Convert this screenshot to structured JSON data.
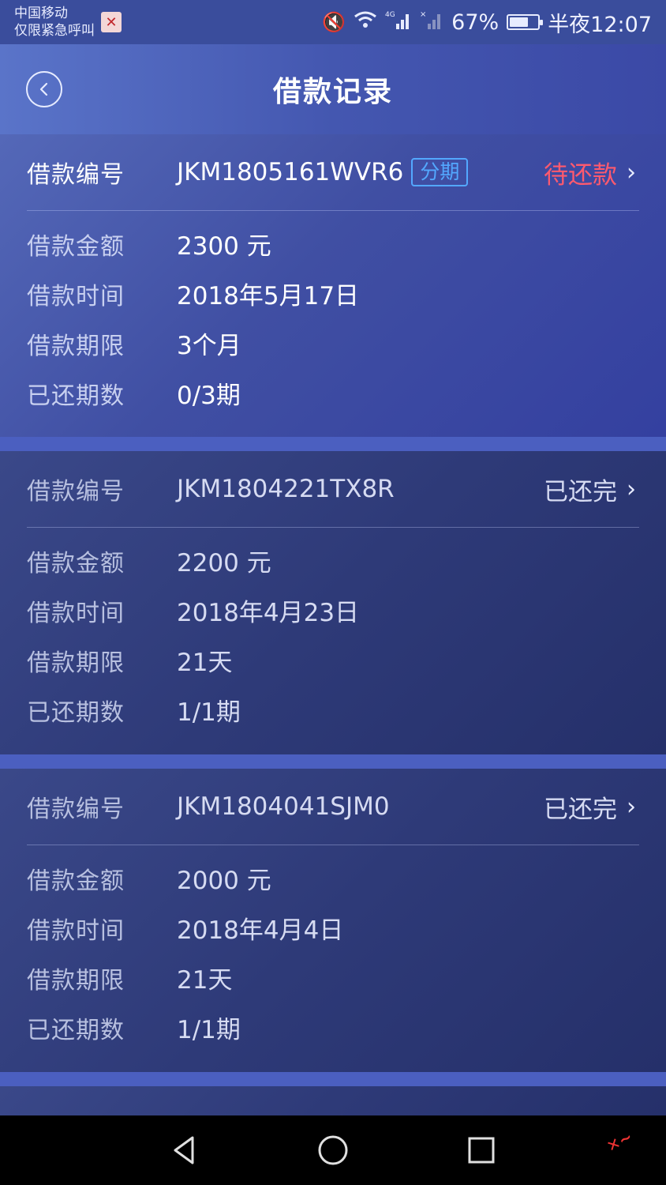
{
  "status_bar": {
    "carrier": "中国移动",
    "carrier_sub": "仅限紧急呼叫",
    "app_icon": "notification-app-icon",
    "network_label": "4G",
    "battery_percent": "67%",
    "battery_level": 0.67,
    "time": "半夜12:07"
  },
  "header": {
    "title": "借款记录",
    "back_icon": "back-chevron-icon"
  },
  "loans": [
    {
      "id_label": "借款编号",
      "id": "JKM1805161WVR6",
      "tag": "分期",
      "status": "待还款",
      "amount_label": "借款金额",
      "amount": "2300 元",
      "date_label": "借款时间",
      "date": "2018年5月17日",
      "term_label": "借款期限",
      "term": "3个月",
      "paid_label": "已还期数",
      "paid": "0/3期"
    },
    {
      "id_label": "借款编号",
      "id": "JKM1804221TX8R",
      "status": "已还完",
      "amount_label": "借款金额",
      "amount": "2200 元",
      "date_label": "借款时间",
      "date": "2018年4月23日",
      "term_label": "借款期限",
      "term": "21天",
      "paid_label": "已还期数",
      "paid": "1/1期"
    },
    {
      "id_label": "借款编号",
      "id": "JKM1804041SJM0",
      "status": "已还完",
      "amount_label": "借款金额",
      "amount": "2000 元",
      "date_label": "借款时间",
      "date": "2018年4月4日",
      "term_label": "借款期限",
      "term": "21天",
      "paid_label": "已还期数",
      "paid": "1/1期"
    }
  ],
  "colors": {
    "pending": "#ff5a6e",
    "tag": "#53a8ff",
    "header": "#4457b0"
  }
}
